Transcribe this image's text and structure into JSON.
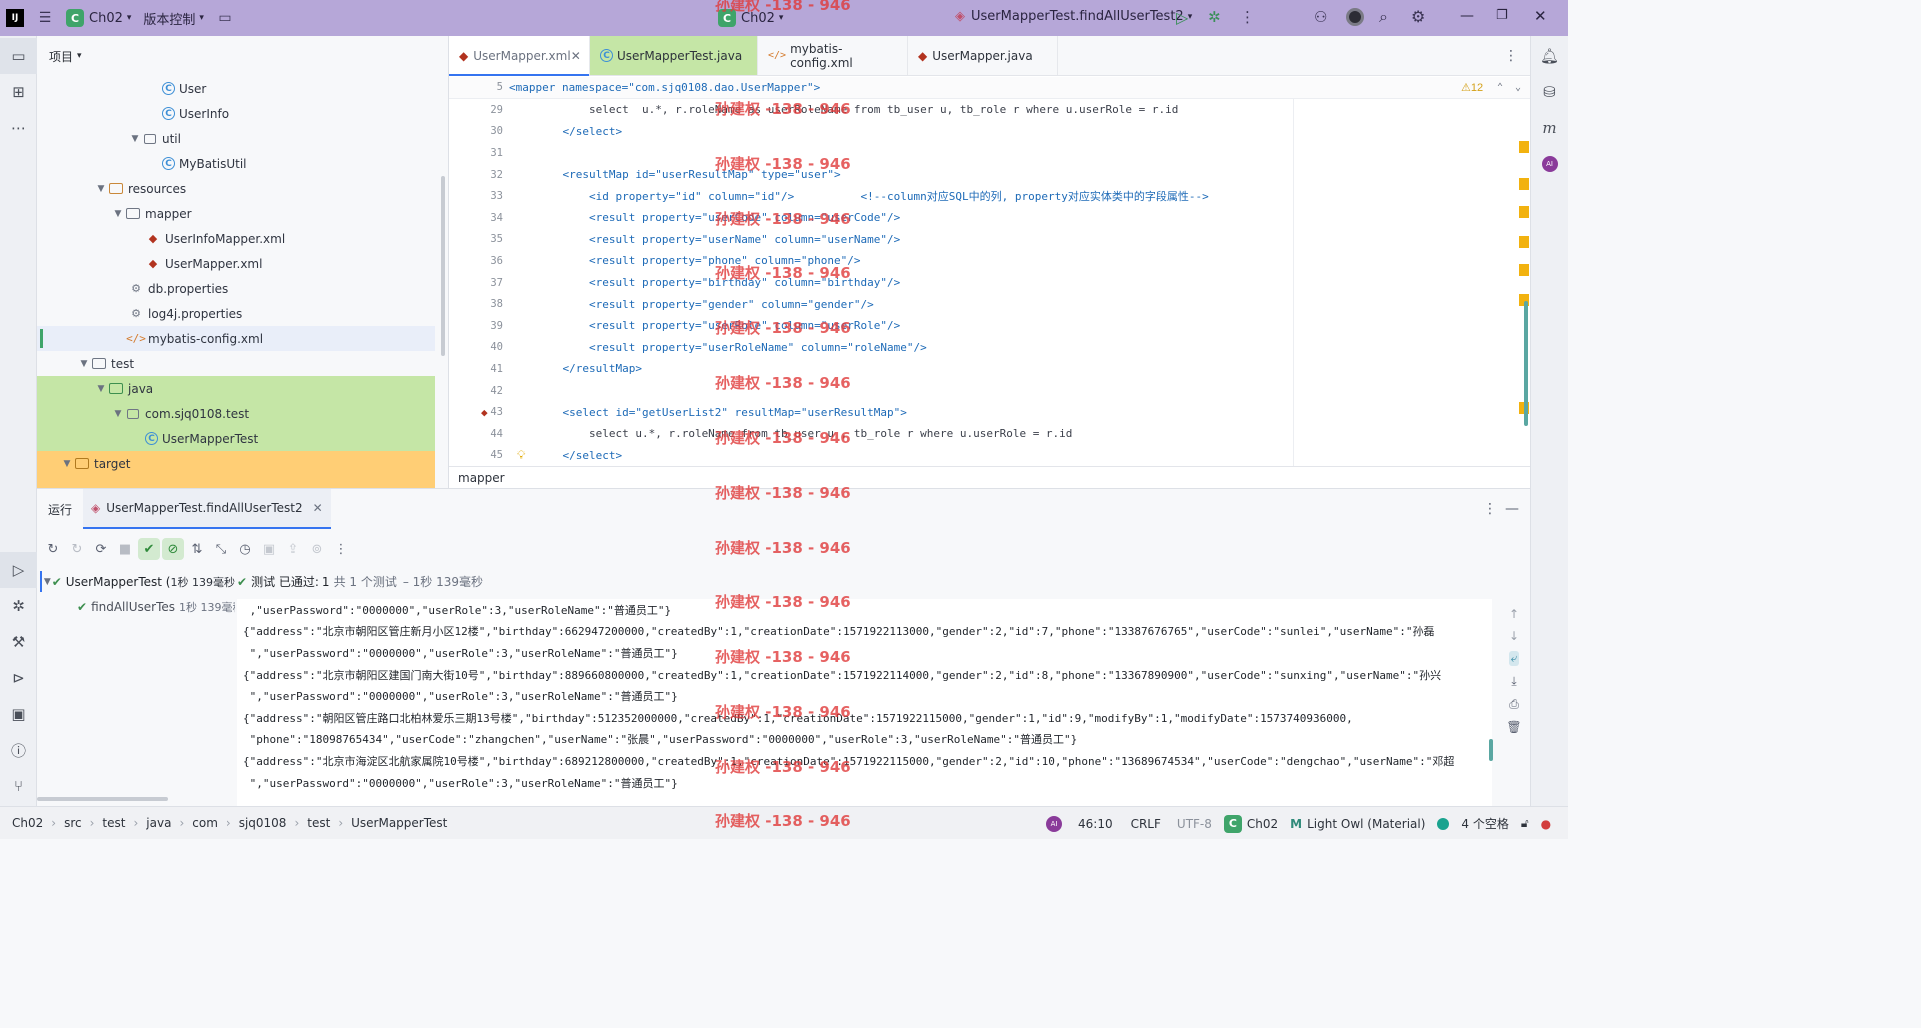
{
  "titlebar": {
    "project_badge": "C",
    "project_name": "Ch02",
    "vcs_label": "版本控制",
    "center_project": "Ch02",
    "run_config": "UserMapperTest.findAllUserTest2"
  },
  "watermark": "孙建权 -138 - 946",
  "project_panel": {
    "header": "项目",
    "tree": [
      {
        "label": "User",
        "icon": "class-icon"
      },
      {
        "label": "UserInfo",
        "icon": "class-icon"
      },
      {
        "label": "util",
        "icon": "package-icon"
      },
      {
        "label": "MyBatisUtil",
        "icon": "class-icon"
      },
      {
        "label": "resources",
        "icon": "resources-folder-icon"
      },
      {
        "label": "mapper",
        "icon": "folder-icon"
      },
      {
        "label": "UserInfoMapper.xml",
        "icon": "mybatis-icon"
      },
      {
        "label": "UserMapper.xml",
        "icon": "mybatis-icon"
      },
      {
        "label": "db.properties",
        "icon": "properties-icon"
      },
      {
        "label": "log4j.properties",
        "icon": "properties-icon"
      },
      {
        "label": "mybatis-config.xml",
        "icon": "xml-icon"
      },
      {
        "label": "test",
        "icon": "folder-icon"
      },
      {
        "label": "java",
        "icon": "test-folder-icon"
      },
      {
        "label": "com.sjq0108.test",
        "icon": "package-icon"
      },
      {
        "label": "UserMapperTest",
        "icon": "test-class-icon"
      },
      {
        "label": "target",
        "icon": "folder-icon"
      }
    ]
  },
  "editor": {
    "tabs": [
      {
        "label": "UserMapper.xml"
      },
      {
        "label": "UserMapperTest.java"
      },
      {
        "label": "mybatis-config.xml"
      },
      {
        "label": "UserMapper.java"
      }
    ],
    "sticky_line_no": "5",
    "sticky_code": "<mapper namespace=\"com.sjq0108.dao.UserMapper\">",
    "warning_count": "12",
    "lines": [
      {
        "no": "29",
        "code": "        select  u.*, r.roleName as userRoleName from tb_user u, tb_role r where u.userRole = r.id"
      },
      {
        "no": "30",
        "code": "    </select>"
      },
      {
        "no": "31",
        "code": ""
      },
      {
        "no": "32",
        "code": "    <resultMap id=\"userResultMap\" type=\"user\">"
      },
      {
        "no": "33",
        "code": "        <id property=\"id\" column=\"id\"/>          <!--column对应SQL中的列, property对应实体类中的字段属性-->"
      },
      {
        "no": "34",
        "code": "        <result property=\"userCode\" column=\"userCode\"/>"
      },
      {
        "no": "35",
        "code": "        <result property=\"userName\" column=\"userName\"/>"
      },
      {
        "no": "36",
        "code": "        <result property=\"phone\" column=\"phone\"/>"
      },
      {
        "no": "37",
        "code": "        <result property=\"birthday\" column=\"birthday\"/>"
      },
      {
        "no": "38",
        "code": "        <result property=\"gender\" column=\"gender\"/>"
      },
      {
        "no": "39",
        "code": "        <result property=\"userRole\" column=\"userRole\"/>"
      },
      {
        "no": "40",
        "code": "        <result property=\"userRoleName\" column=\"roleName\"/>"
      },
      {
        "no": "41",
        "code": "    </resultMap>"
      },
      {
        "no": "42",
        "code": ""
      },
      {
        "no": "43",
        "code": "    <select id=\"getUserList2\" resultMap=\"userResultMap\">"
      },
      {
        "no": "44",
        "code": "        select u.*, r.roleName from tb_user u , tb_role r where u.userRole = r.id"
      },
      {
        "no": "45",
        "code": "    </select>"
      }
    ],
    "breadcrumb": "mapper"
  },
  "run": {
    "title": "运行",
    "tab_label": "UserMapperTest.findAllUserTest2",
    "test_root": "UserMapperTest (",
    "test_root_time": "1秒 139毫秒",
    "test_child": "findAllUserTes",
    "test_child_time": "1秒 139毫秒",
    "status_passed": "测试 已通过:",
    "status_count": "1",
    "status_total": "共 1 个测试",
    "status_time": "– 1秒 139毫秒",
    "console": [
      " ,\"userPassword\":\"0000000\",\"userRole\":3,\"userRoleName\":\"普通员工\"}",
      "{\"address\":\"北京市朝阳区管庄新月小区12楼\",\"birthday\":662947200000,\"createdBy\":1,\"creationDate\":1571922113000,\"gender\":2,\"id\":7,\"phone\":\"13387676765\",\"userCode\":\"sunlei\",\"userName\":\"孙磊",
      " \",\"userPassword\":\"0000000\",\"userRole\":3,\"userRoleName\":\"普通员工\"}",
      "{\"address\":\"北京市朝阳区建国门南大街10号\",\"birthday\":889660800000,\"createdBy\":1,\"creationDate\":1571922114000,\"gender\":2,\"id\":8,\"phone\":\"13367890900\",\"userCode\":\"sunxing\",\"userName\":\"孙兴",
      " \",\"userPassword\":\"0000000\",\"userRole\":3,\"userRoleName\":\"普通员工\"}",
      "{\"address\":\"朝阳区管庄路口北柏林爱乐三期13号楼\",\"birthday\":512352000000,\"createdBy\":1,\"creationDate\":1571922115000,\"gender\":1,\"id\":9,\"modifyBy\":1,\"modifyDate\":1573740936000,",
      " \"phone\":\"18098765434\",\"userCode\":\"zhangchen\",\"userName\":\"张晨\",\"userPassword\":\"0000000\",\"userRole\":3,\"userRoleName\":\"普通员工\"}",
      "{\"address\":\"北京市海淀区北航家属院10号楼\",\"birthday\":689212800000,\"createdBy\":1,\"creationDate\":1571922115000,\"gender\":2,\"id\":10,\"phone\":\"13689674534\",\"userCode\":\"dengchao\",\"userName\":\"邓超",
      " \",\"userPassword\":\"0000000\",\"userRole\":3,\"userRoleName\":\"普通员工\"}"
    ]
  },
  "statusbar": {
    "crumbs": [
      "Ch02",
      "src",
      "test",
      "java",
      "com",
      "sjq0108",
      "test",
      "UserMapperTest"
    ],
    "position": "46:10",
    "line_sep": "CRLF",
    "encoding": "UTF-8",
    "project": "Ch02",
    "theme": "Light Owl (Material)",
    "indent": "4 个空格"
  },
  "colors": {
    "titlebar": "#b6a7d8",
    "test_green": "#c5e6a6",
    "excluded_orange": "#ffce75",
    "accent": "#3574f0"
  }
}
